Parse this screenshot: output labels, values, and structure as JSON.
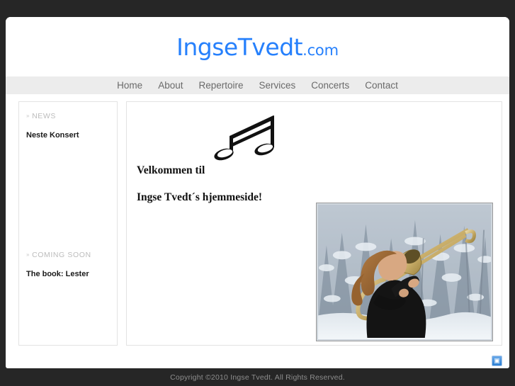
{
  "site": {
    "logo_name": "IngseTvedt",
    "logo_tld": ".com",
    "accent_color": "#2680fc",
    "background_color": "#262626"
  },
  "nav": {
    "items": [
      {
        "label": "Home"
      },
      {
        "label": "About"
      },
      {
        "label": "Repertoire"
      },
      {
        "label": "Services"
      },
      {
        "label": "Concerts"
      },
      {
        "label": "Contact"
      }
    ]
  },
  "sidebar": {
    "blocks": [
      {
        "bullet": "»",
        "heading": "NEWS",
        "link": "Neste Konsert"
      },
      {
        "bullet": "»",
        "heading": "COMING SOON",
        "link": "The book: Lester"
      }
    ]
  },
  "main": {
    "art_icon": "music-notes-icon",
    "welcome_line_1": "Velkommen til",
    "welcome_line_2": "Ingse Tvedt´s hjemmeside!",
    "photo_alt": "trombone-player-in-snowy-forest"
  },
  "badge": {
    "icon": "plugin-icon",
    "glyph": "▣"
  },
  "footer": {
    "copyright": "Copyright ©2010 Ingse Tvedt. All Rights Reserved."
  }
}
